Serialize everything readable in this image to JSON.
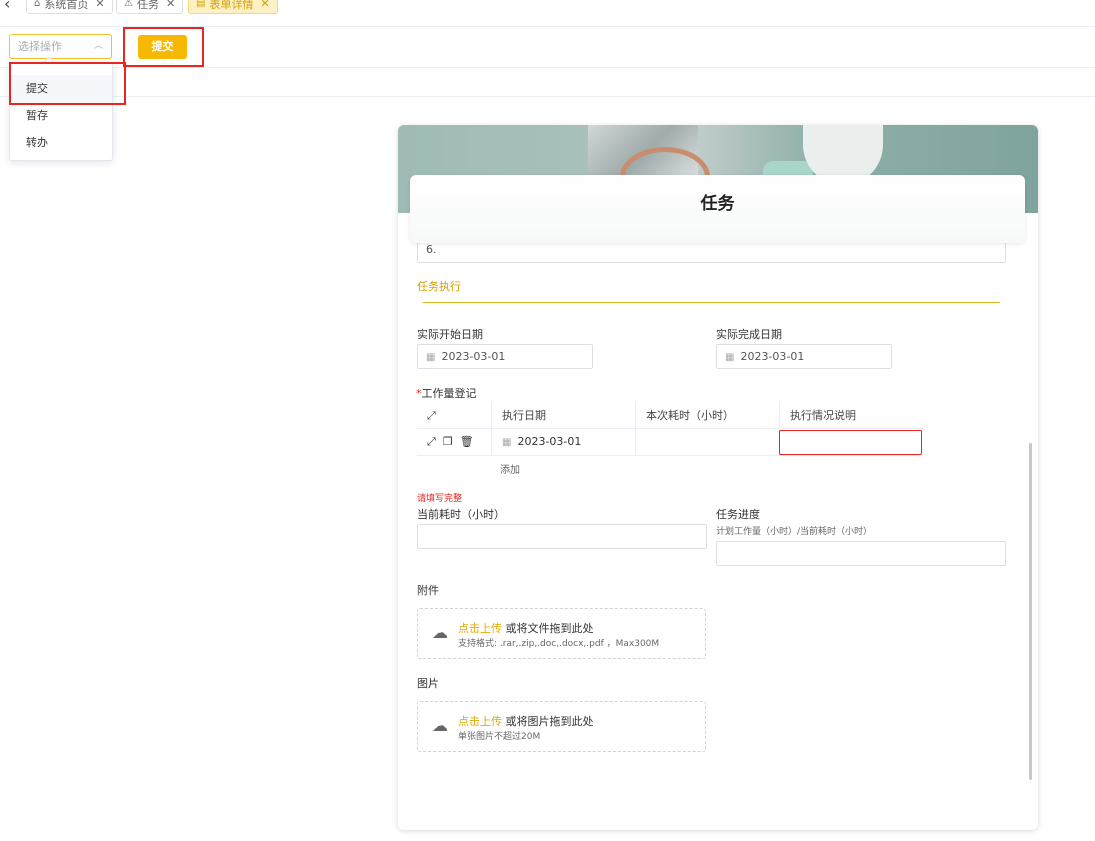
{
  "tabs": [
    {
      "label": "系统首页",
      "icon": "home-icon",
      "active": false
    },
    {
      "label": "任务",
      "icon": "warning-icon",
      "active": false
    },
    {
      "label": "表单详情",
      "icon": "form-icon",
      "active": true
    }
  ],
  "toolbar": {
    "select_placeholder": "选择操作",
    "submit_label": "提交",
    "options": [
      "提交",
      "暂存",
      "转办"
    ]
  },
  "form": {
    "title": "任务",
    "prev_value": "6.",
    "section_title": "任务执行",
    "actual_start_label": "实际开始日期",
    "actual_start_value": "2023-03-01",
    "actual_end_label": "实际完成日期",
    "actual_end_value": "2023-03-01",
    "worklog_label": "工作量登记",
    "worklog_required": "*",
    "worklog_columns": [
      "执行日期",
      "本次耗时（小时）",
      "执行情况说明"
    ],
    "worklog_rows": [
      {
        "date": "2023-03-01",
        "hours": "",
        "desc": ""
      }
    ],
    "add_label": "添加",
    "error_text": "请填写完整",
    "current_hours_label": "当前耗时（小时）",
    "progress_label": "任务进度",
    "progress_hint": "计划工作量（小时）/当前耗时（小时）",
    "attachment_label": "附件",
    "attachment_link": "点击上传",
    "attachment_main": "或将文件拖到此处",
    "attachment_hint": "支持格式: .rar,.zip,.doc,.docx,.pdf ，Max300M",
    "image_label": "图片",
    "image_link": "点击上传",
    "image_main": "或将图片拖到此处",
    "image_hint": "单张图片不超过20M"
  },
  "colors": {
    "accent": "#f6b800",
    "error": "#e8251f",
    "highlight": "#e8251f"
  }
}
